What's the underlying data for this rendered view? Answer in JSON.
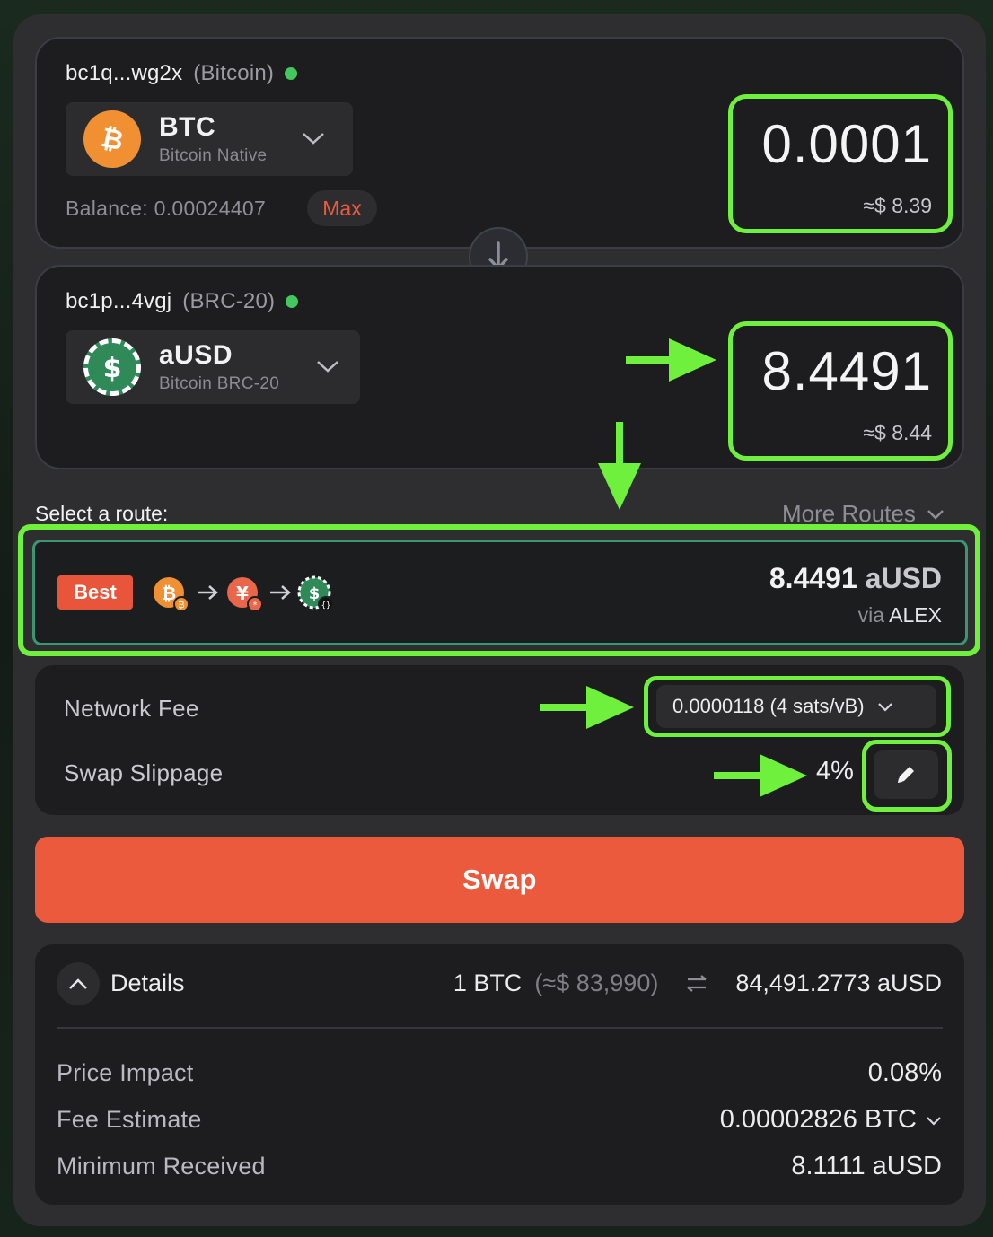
{
  "from": {
    "address": "bc1q...wg2x",
    "network": "(Bitcoin)",
    "token_symbol": "BTC",
    "token_sub": "Bitcoin Native",
    "amount": "0.0001",
    "usd": "≈$ 8.39",
    "balance": "Balance: 0.00024407",
    "max_label": "Max"
  },
  "to": {
    "address": "bc1p...4vgj",
    "network": "(BRC-20)",
    "token_symbol": "aUSD",
    "token_sub": "Bitcoin BRC-20",
    "amount": "8.4491",
    "usd": "≈$ 8.44"
  },
  "route": {
    "label": "Select a route:",
    "more_routes": "More Routes",
    "badge": "Best",
    "amount": "8.4491",
    "unit": "aUSD",
    "via": "via",
    "dex": "ALEX"
  },
  "fees": {
    "network_fee_label": "Network Fee",
    "network_fee_value": "0.0000118 (4 sats/vB)",
    "slippage_label": "Swap Slippage",
    "slippage_value": "4%"
  },
  "swap_label": "Swap",
  "details": {
    "title": "Details",
    "rate_from": "1 BTC",
    "rate_from_usd": "(≈$ 83,990)",
    "rate_to": "84,491.2773 aUSD",
    "rows": [
      {
        "label": "Price Impact",
        "value": "0.08%"
      },
      {
        "label": "Fee Estimate",
        "value": "0.00002826 BTC"
      },
      {
        "label": "Minimum Received",
        "value": "8.1111 aUSD"
      }
    ]
  },
  "colors": {
    "accent": "#ec5a3d",
    "highlight": "#6ff03d",
    "status_dot": "#43c85d",
    "btc": "#f09033",
    "ausd": "#2f8a58"
  },
  "icons": [
    "bitcoin-icon",
    "ausd-icon",
    "chevron-down-icon",
    "arrow-down-icon",
    "arrow-right-icon",
    "pencil-icon",
    "chevron-up-icon",
    "swap-arrows-icon"
  ]
}
